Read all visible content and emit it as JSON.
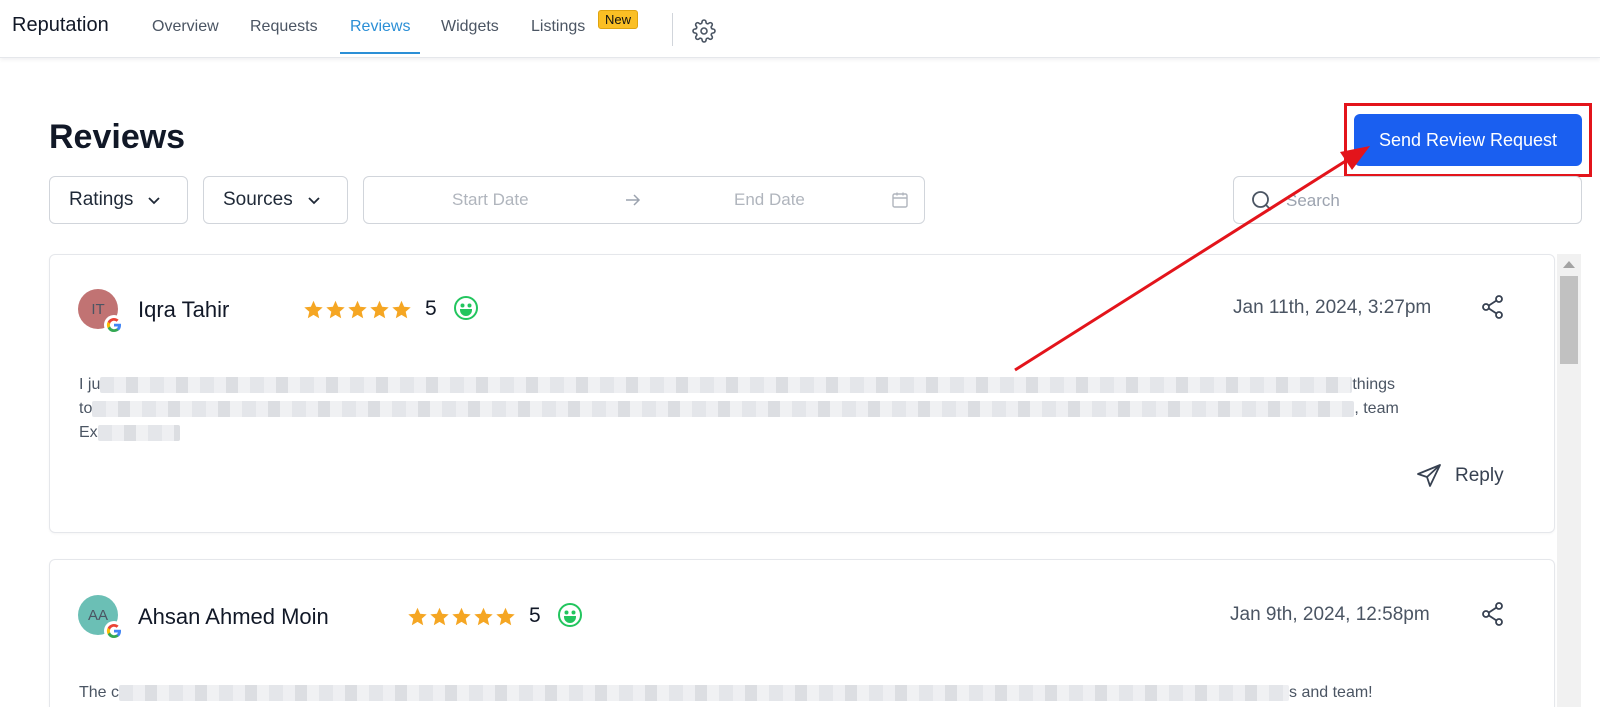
{
  "nav": {
    "brand": "Reputation",
    "tabs": [
      {
        "label": "Overview"
      },
      {
        "label": "Requests"
      },
      {
        "label": "Reviews"
      },
      {
        "label": "Widgets"
      },
      {
        "label": "Listings"
      }
    ],
    "new_badge": "New",
    "settings_icon": "gear-icon"
  },
  "page": {
    "title": "Reviews",
    "send_button": "Send Review Request"
  },
  "filters": {
    "ratings": "Ratings",
    "sources": "Sources",
    "start_placeholder": "Start Date",
    "end_placeholder": "End Date",
    "search_placeholder": "Search"
  },
  "reviews": [
    {
      "initials": "IT",
      "avatar_color": "#c17373",
      "name": "Iqra Tahir",
      "rating": "5",
      "date": "Jan 11th, 2024, 3:27pm",
      "text_line1_start": "I ju",
      "text_line1_end": "things",
      "text_line2_start": "to",
      "text_line2_end": ", team",
      "text_line3_start": "Ex",
      "reply_label": "Reply"
    },
    {
      "initials": "AA",
      "avatar_color": "#6bbfb5",
      "name": "Ahsan Ahmed Moin",
      "rating": "5",
      "date": "Jan 9th, 2024, 12:58pm",
      "text_line1_start": "The c",
      "text_line1_end": "s and team!"
    }
  ],
  "colors": {
    "accent": "#2b8fd6",
    "primary_button": "#1a5ff0",
    "star": "#f5a623",
    "smile": "#22c55e",
    "annotation": "#e3141b"
  }
}
